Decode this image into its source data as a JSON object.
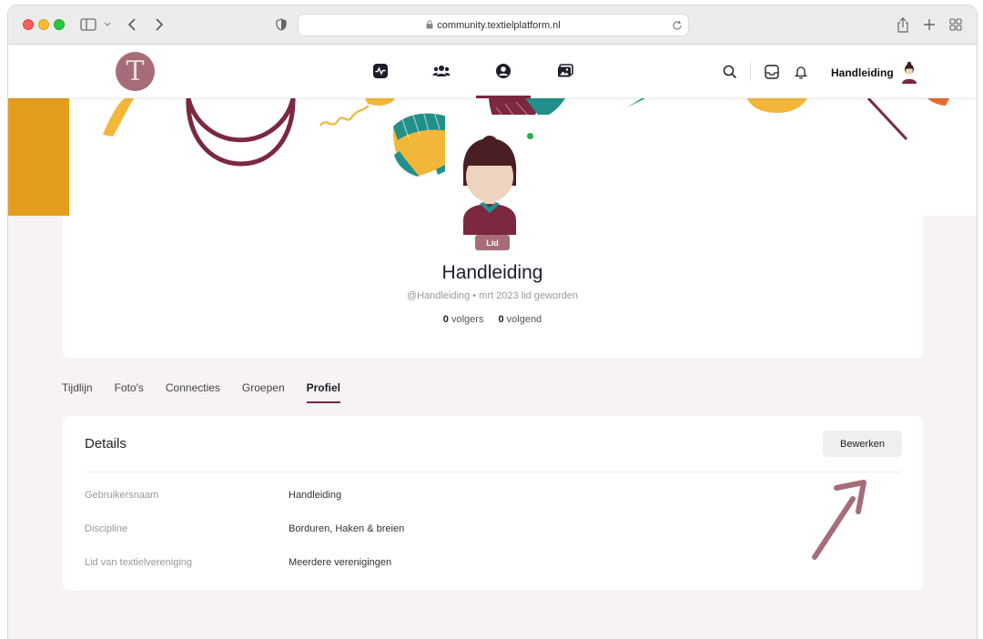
{
  "browser": {
    "url": "community.textielplatform.nl"
  },
  "header": {
    "logo_letter": "T",
    "nav": [
      {
        "name": "activity",
        "icon": "activity-icon"
      },
      {
        "name": "members",
        "icon": "members-icon"
      },
      {
        "name": "profile",
        "icon": "profile-icon",
        "active": true
      },
      {
        "name": "photos",
        "icon": "photos-icon"
      }
    ],
    "username": "Handleiding"
  },
  "profile": {
    "badge": "Lid",
    "name": "Handleiding",
    "meta": "@Handleiding • mrt 2023 lid geworden",
    "followers_count": "0",
    "followers_label": "volgers",
    "following_count": "0",
    "following_label": "volgend"
  },
  "tabs": [
    "Tijdlijn",
    "Foto's",
    "Connecties",
    "Groepen",
    "Profiel"
  ],
  "active_tab": "Profiel",
  "details": {
    "title": "Details",
    "edit_label": "Bewerken",
    "rows": [
      {
        "label": "Gebruikersnaam",
        "value": "Handleiding"
      },
      {
        "label": "Discipline",
        "value": "Borduren, Haken & breien"
      },
      {
        "label": "Lid van textielvereniging",
        "value": "Meerdere verenigingen"
      }
    ]
  },
  "colors": {
    "accent": "#7b2840",
    "brand": "#a66d78",
    "online": "#22b14c"
  }
}
